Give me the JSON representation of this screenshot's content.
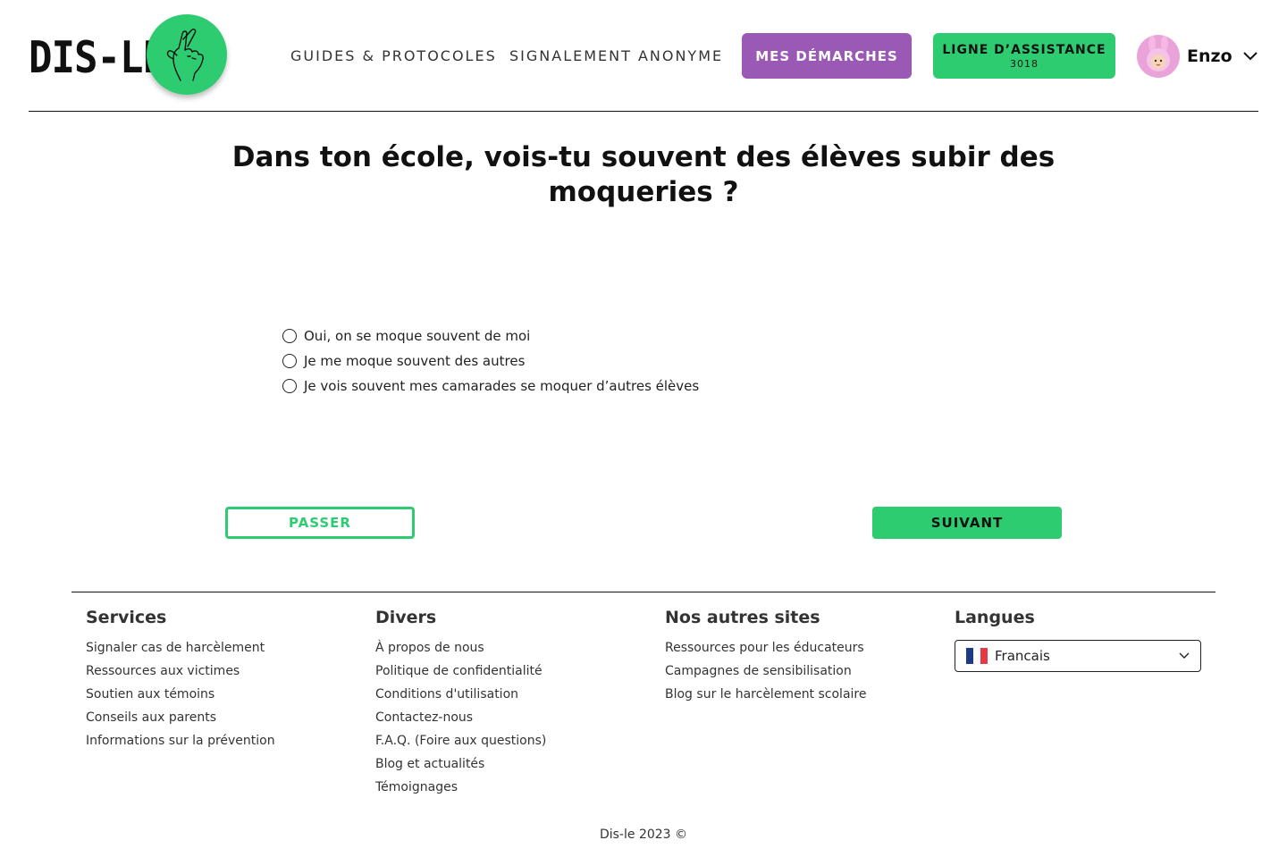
{
  "brand": {
    "name": "DIS-LE"
  },
  "nav": {
    "guides": "GUIDES & PROTOCOLES",
    "signalement": "SIGNALEMENT ANONYME",
    "demarches": "MES DÉMARCHES",
    "assistance": "LIGNE D’ASSISTANCE",
    "assistance_number": "3018"
  },
  "user": {
    "name": "Enzo"
  },
  "question": {
    "title": "Dans ton école, vois-tu souvent des élèves subir des moqueries ?",
    "options": [
      "Oui, on se moque souvent de moi",
      "Je me moque souvent des autres",
      "Je vois souvent mes camarades se moquer d’autres élèves"
    ]
  },
  "actions": {
    "skip": "PASSER",
    "next": "SUIVANT"
  },
  "footer": {
    "services": {
      "title": "Services",
      "links": [
        "Signaler cas de harcèlement",
        "Ressources aux victimes",
        "Soutien aux témoins",
        "Conseils aux parents",
        "Informations sur la prévention"
      ]
    },
    "divers": {
      "title": "Divers",
      "links": [
        "À propos de nous",
        "Politique de confidentialité",
        "Conditions d'utilisation",
        "Contactez-nous",
        "F.A.Q. (Foire aux questions)",
        "Blog et actualités",
        "Témoignages"
      ]
    },
    "sites": {
      "title": "Nos autres sites",
      "links": [
        "Ressources pour les éducateurs",
        "Campagnes de sensibilisation",
        "Blog sur le harcèlement scolaire"
      ]
    },
    "langues": {
      "title": "Langues",
      "selected": "Francais"
    },
    "copyright": "Dis-le 2023 ©"
  },
  "colors": {
    "green": "#2ecc71",
    "purple": "#9b59b6"
  }
}
